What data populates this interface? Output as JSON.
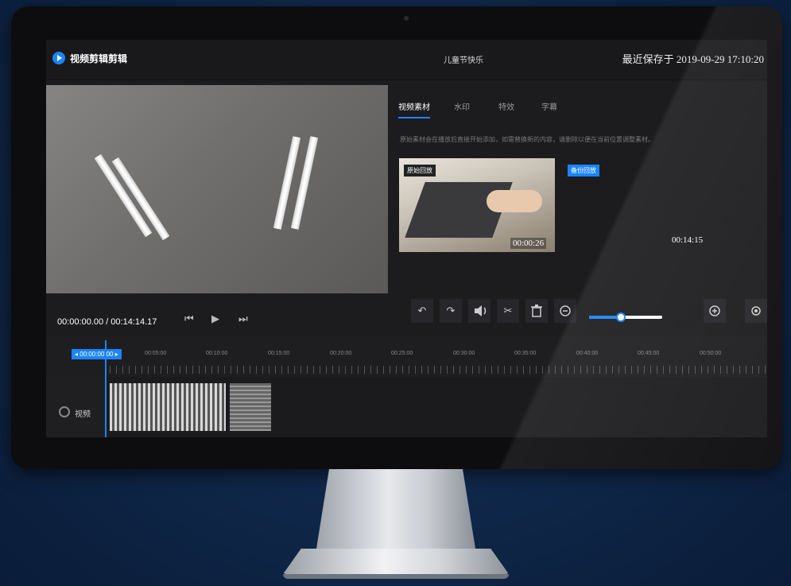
{
  "app": {
    "title": "视频剪辑剪辑",
    "project_name": "儿童节快乐",
    "last_saved": "最近保存于 2019-09-29 17:10:20"
  },
  "preview": {
    "timecode": "00:00:00.00 / 00:14:14.17"
  },
  "tabs": [
    {
      "label": "视频素材",
      "active": true
    },
    {
      "label": "水印",
      "active": false
    },
    {
      "label": "特效",
      "active": false
    },
    {
      "label": "字幕",
      "active": false
    }
  ],
  "assets": {
    "hint": "原始素材会在播放后直接开始添加，如需替换新的内容，请删除以便在当前位置调整素材。",
    "items": [
      {
        "badge": "原始回放",
        "duration": "00:00:26"
      },
      {
        "badge": "备份回放",
        "duration": "00:14:15"
      }
    ]
  },
  "toolbar": {
    "tools": [
      {
        "name": "undo-icon",
        "glyph": "↶"
      },
      {
        "name": "redo-icon",
        "glyph": "↷"
      },
      {
        "name": "volume-icon",
        "glyph": "🔊"
      },
      {
        "name": "scissors-icon",
        "glyph": "✂"
      },
      {
        "name": "trash-icon",
        "glyph": "🗑"
      }
    ],
    "zoom_level": 0.4,
    "more_label": "设置"
  },
  "timeline": {
    "playhead": "◂ 00:00:00.00 ▸",
    "ticks": [
      "00:05:00",
      "00:10:00",
      "00:15:00",
      "00:20:00",
      "00:25:00",
      "00:30:00",
      "00:35:00",
      "00:40:00",
      "00:45:00",
      "00:50:00"
    ],
    "track_label": "视频"
  },
  "colors": {
    "accent": "#1a85ff",
    "background": "#1c1c1f"
  }
}
